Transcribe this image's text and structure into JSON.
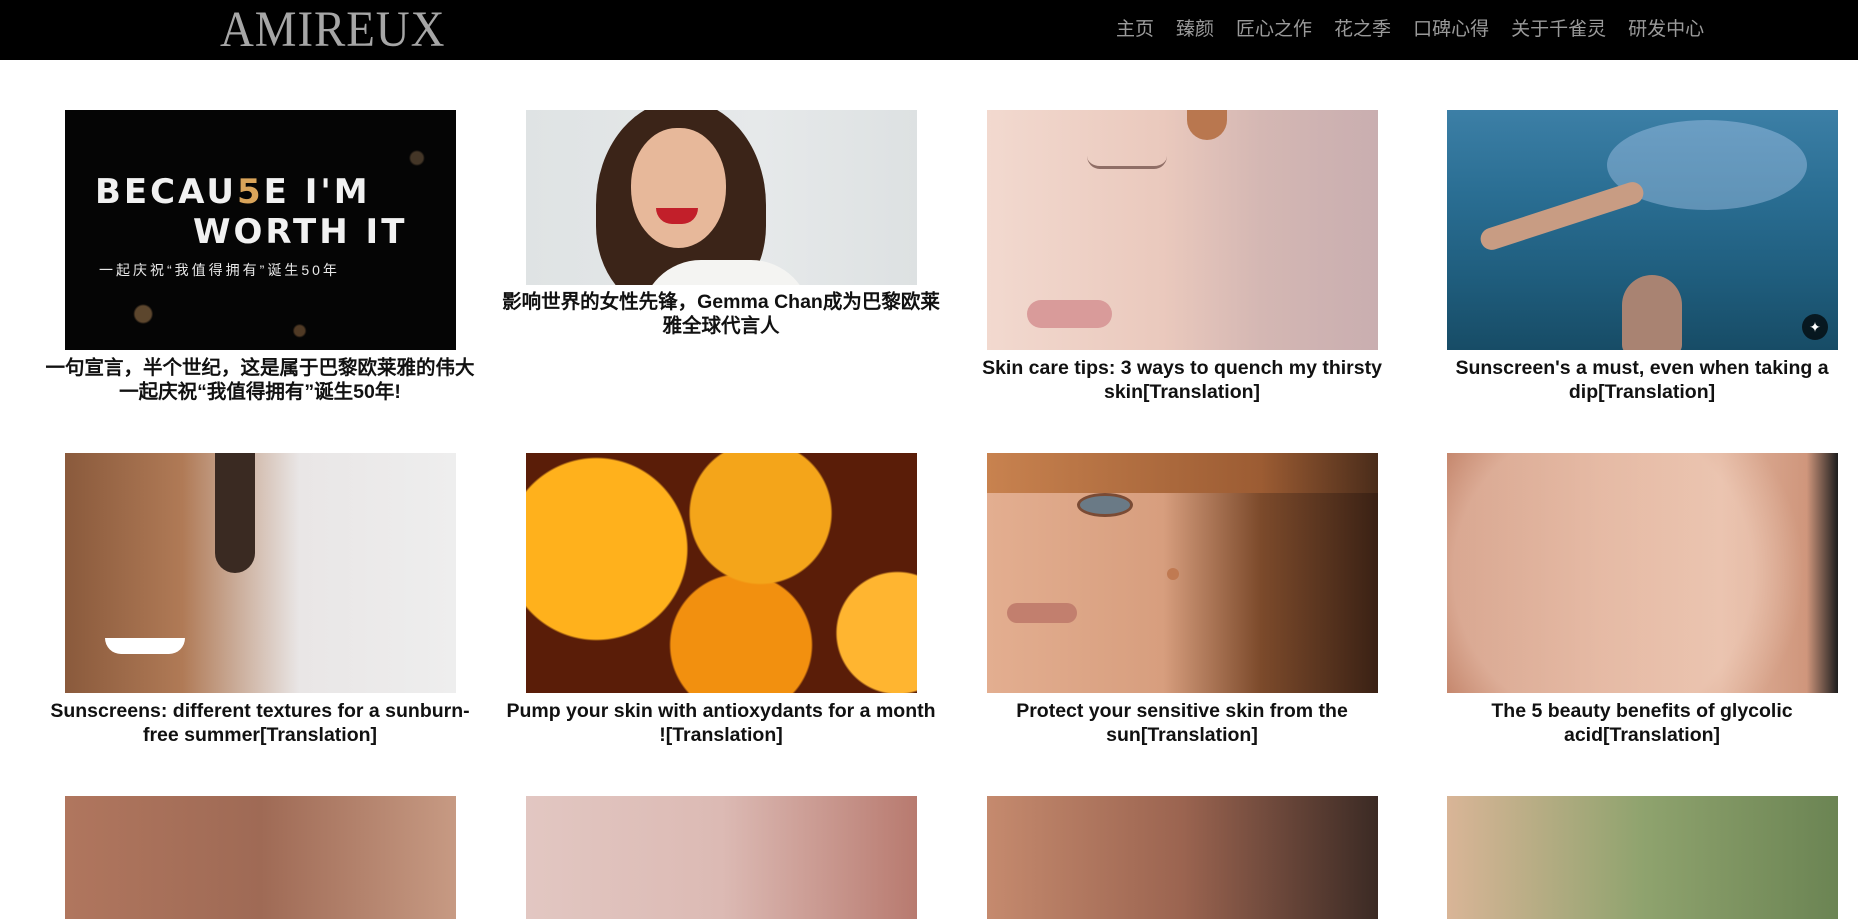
{
  "header": {
    "logo": "AMIREUX",
    "nav": [
      "主页",
      "臻颜",
      "匠心之作",
      "花之季",
      "口碑心得",
      "关于千雀灵",
      "研发中心"
    ]
  },
  "thumb_text": {
    "line1": "BECAU",
    "five": "5",
    "line1_end": "E  I'M",
    "line2": "WORTH IT",
    "sub": "一起庆祝“我值得拥有”诞生50年"
  },
  "articles": [
    {
      "title": "一句宣言，半个世纪，这是属于巴黎欧莱雅的伟大一起庆祝“我值得拥有”诞生50年!"
    },
    {
      "title": "影响世界的女性先锋，Gemma Chan成为巴黎欧莱雅全球代言人"
    },
    {
      "title": "Skin care tips: 3 ways to quench my thirsty skin[Translation]"
    },
    {
      "title": "Sunscreen's a must, even when taking a dip[Translation]"
    },
    {
      "title": "Sunscreens: different textures for a sunburn-free summer[Translation]"
    },
    {
      "title": "Pump your skin with antioxydants for a month ![Translation]"
    },
    {
      "title": "Protect your sensitive skin from the sun[Translation]"
    },
    {
      "title": "The 5 beauty benefits of glycolic acid[Translation]"
    }
  ]
}
